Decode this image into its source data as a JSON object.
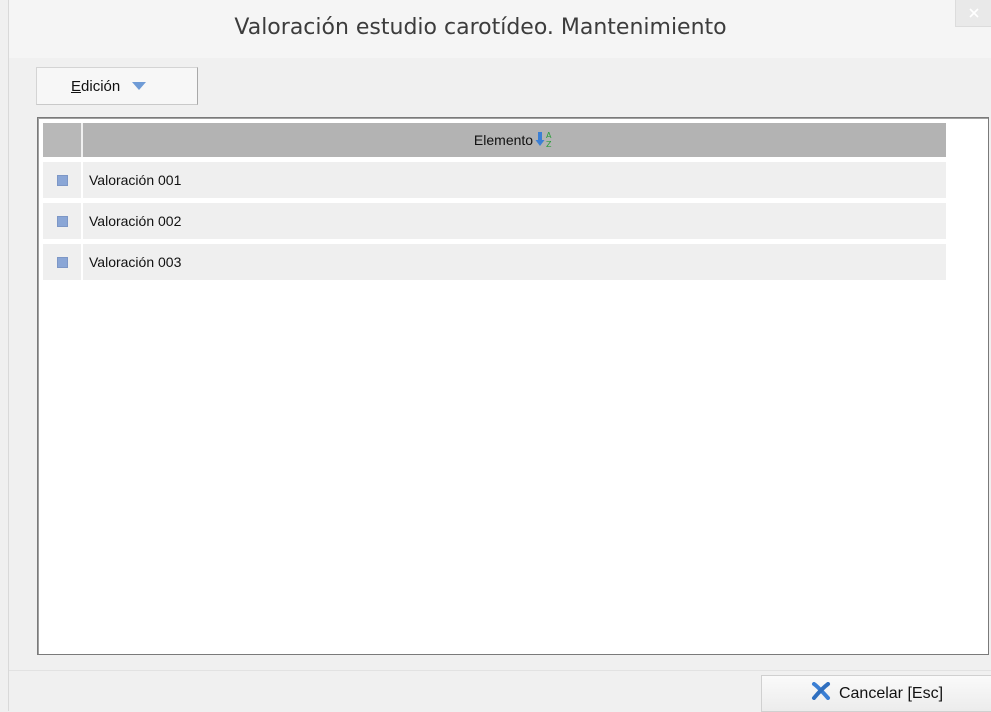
{
  "window": {
    "title": "Valoración estudio carotídeo. Mantenimiento"
  },
  "toolbar": {
    "edition_label": "Edición",
    "edition_accesskey": "E"
  },
  "grid": {
    "columns": [
      {
        "header": "Elemento",
        "sort": "ascending"
      }
    ],
    "rows": [
      {
        "elemento": "Valoración 001"
      },
      {
        "elemento": "Valoración 002"
      },
      {
        "elemento": "Valoración 003"
      }
    ]
  },
  "footer": {
    "cancel_label": "Cancelar  [Esc]"
  },
  "colors": {
    "accent": "#6f9bd6",
    "row_marker": "#8aa6d6",
    "cancel_icon": "#3b7fd4"
  },
  "icons": {
    "close": "close-icon",
    "dropdown": "triangle-down-icon",
    "sort": "sort-az-icon",
    "cancel": "x-icon"
  }
}
